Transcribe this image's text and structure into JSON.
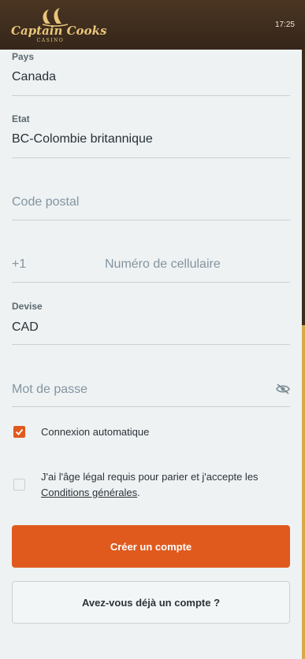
{
  "header": {
    "logo_text": "Captain Cooks",
    "logo_sub": "CASINO",
    "time": "17:25"
  },
  "form": {
    "country": {
      "label": "Pays",
      "value": "Canada"
    },
    "state": {
      "label": "Etat",
      "value": "BC-Colombie britannique"
    },
    "postal": {
      "placeholder": "Code postal"
    },
    "phone": {
      "prefix": "+1",
      "placeholder": "Numéro de cellulaire"
    },
    "currency": {
      "label": "Devise",
      "value": "CAD"
    },
    "password": {
      "placeholder": "Mot de passe",
      "icon": "eye-off-icon"
    },
    "auto_login": {
      "label": "Connexion automatique",
      "checked": true
    },
    "terms": {
      "text": "J'ai l'âge légal requis pour parier et j'accepte les",
      "link": "Conditions générales",
      "suffix": ".",
      "checked": false
    },
    "create_button": "Créer un compte",
    "login_button": "Avez-vous déjà un compte ?"
  },
  "colors": {
    "accent": "#e05a1e",
    "header": "#3d2c1e",
    "background": "#eef2f3"
  }
}
